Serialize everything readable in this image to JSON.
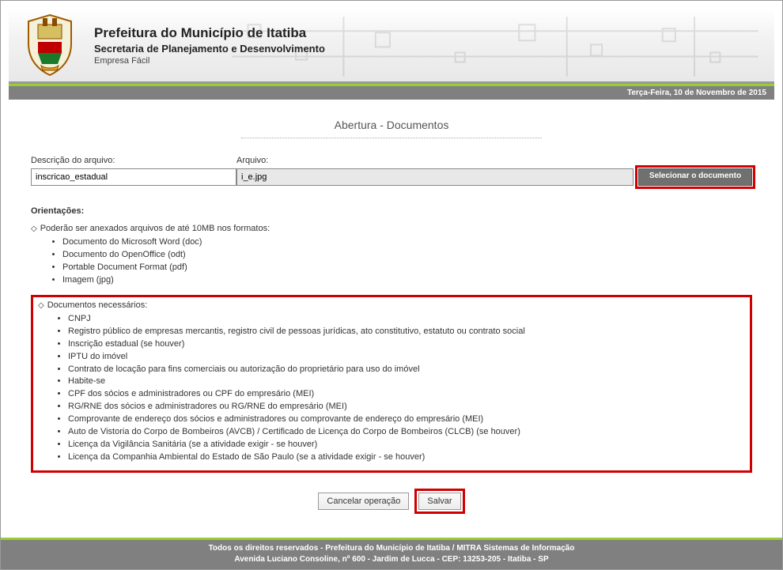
{
  "header": {
    "title": "Prefeitura do Município de Itatiba",
    "subtitle": "Secretaria de Planejamento e Desenvolvimento",
    "module": "Empresa Fácil"
  },
  "datebar": "Terça-Feira, 10 de Novembro de 2015",
  "page_title": "Abertura - Documentos",
  "form": {
    "desc_label": "Descrição do arquivo:",
    "desc_value": "inscricao_estadual",
    "file_label": "Arquivo:",
    "file_value": "i_e.jpg",
    "select_btn": "Selecionar o documento"
  },
  "orientacoes": {
    "heading": "Orientações:",
    "line_formats": "Poderão ser anexados arquivos de até 10MB nos formatos:",
    "formats": [
      "Documento do Microsoft Word (doc)",
      "Documento do OpenOffice (odt)",
      "Portable Document Format (pdf)",
      "Imagem (jpg)"
    ],
    "docs_heading": "Documentos necessários:",
    "docs": [
      "CNPJ",
      "Registro público de empresas mercantis, registro civil de pessoas jurídicas, ato constitutivo, estatuto ou contrato social",
      "Inscrição estadual (se houver)",
      "IPTU do imóvel",
      "Contrato de locação para fins comerciais ou autorização do proprietário para uso do imóvel",
      "Habite-se",
      "CPF dos sócios e administradores ou CPF do empresário (MEI)",
      "RG/RNE dos sócios e administradores ou RG/RNE do empresário (MEI)",
      "Comprovante de endereço dos sócios e administradores ou comprovante de endereço do empresário (MEI)",
      "Auto de Vistoria do Corpo de Bombeiros (AVCB) / Certificado de Licença do Corpo de Bombeiros (CLCB) (se houver)",
      "Licença da Vigilância Sanitária (se a atividade exigir - se houver)",
      "Licença da Companhia Ambiental do Estado de São Paulo (se a atividade exigir - se houver)"
    ]
  },
  "actions": {
    "cancel": "Cancelar operação",
    "save": "Salvar"
  },
  "footer": {
    "line1": "Todos os direitos reservados - Prefeitura do Município de Itatiba / MITRA Sistemas de Informação",
    "line2": "Avenida Luciano Consoline, nº 600 - Jardim de Lucca - CEP: 13253-205 - Itatiba - SP"
  }
}
